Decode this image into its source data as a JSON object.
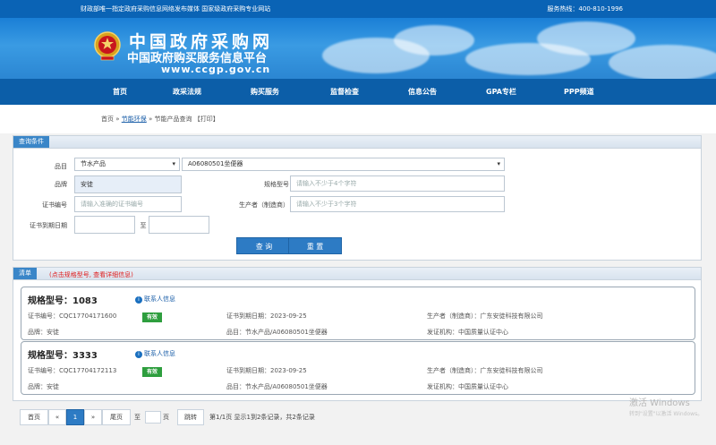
{
  "topbar": {
    "left_text": "财政部唯一指定政府采购信息网络发布媒体  国家级政府采购专业网站",
    "hotline": "服务热线：400-810-1996"
  },
  "banner": {
    "title": "中国政府采购网",
    "subtitle": "中国政府购买服务信息平台",
    "url": "www.ccgp.gov.cn"
  },
  "nav": {
    "items": [
      "首页",
      "政采法规",
      "购买服务",
      "监督检查",
      "信息公告",
      "GPA专栏",
      "PPP频道"
    ]
  },
  "breadcrumb": {
    "home": "首页",
    "sep1": " » ",
    "section": "节能环保",
    "sep2": " » ",
    "current": "节能产品查询",
    "print": "【打印】"
  },
  "query": {
    "tag": "查询条件",
    "category_label": "品目",
    "category_value": "节水产品",
    "category2_value": "A06080501坐便器",
    "brand_label": "品牌",
    "brand_value": "安徒",
    "model_label": "规格型号",
    "model_placeholder": "请输入不少于4个字符",
    "cert_label": "证书编号",
    "cert_placeholder": "请输入准确的证书编号",
    "maker_label": "生产者（制造商）",
    "maker_placeholder": "请输入不少于3个字符",
    "expiry_label": "证书到期日期",
    "to": "至",
    "search_button": "查 询",
    "reset_button": "重 置"
  },
  "results": {
    "tag": "清单",
    "hint": "(点击规格型号, 查看详细信息)",
    "contact_text": "联系人信息",
    "items": [
      {
        "model": "规格型号：1083",
        "cert": "证书编号：CQC17704171600",
        "status": "有效",
        "expiry": "证书到期日期：2023-09-25",
        "maker": "生产者（制造商）：广东安徒科技有限公司",
        "brand": "品牌：安徒",
        "category": "品目：节水产品/A06080501坐便器",
        "issuer": "发证机构：中国质量认证中心"
      },
      {
        "model": "规格型号：3333",
        "cert": "证书编号：CQC17704172113",
        "status": "有效",
        "expiry": "证书到期日期：2023-09-25",
        "maker": "生产者（制造商）：广东安徒科技有限公司",
        "brand": "品牌：安徒",
        "category": "品目：节水产品/A06080501坐便器",
        "issuer": "发证机构：中国质量认证中心"
      }
    ]
  },
  "pager": {
    "first": "首页",
    "prev": "«",
    "page": "1",
    "next": "»",
    "last": "尾页",
    "goto_prefix": "至",
    "goto_suffix": "页",
    "jump": "跳转",
    "summary": "第1/1页  显示1到2条记录，共2条记录"
  },
  "watermark": {
    "title": "激活 Windows",
    "subtitle": "转到\"设置\"以激活 Windows。"
  },
  "colors": {
    "brand_blue": "#0c5ea8",
    "accent_blue": "#2d7bc4",
    "valid_green": "#2e9e3e",
    "hint_red": "#e02020"
  }
}
